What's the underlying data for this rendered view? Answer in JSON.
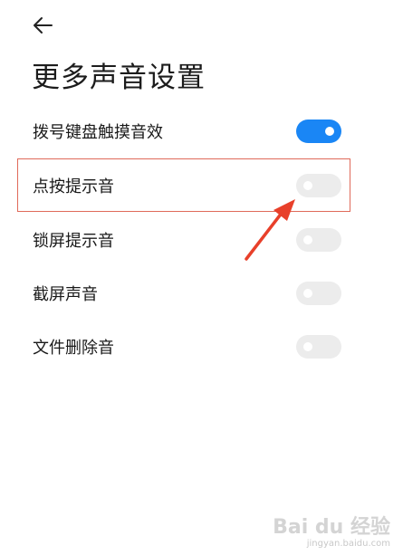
{
  "header": {
    "back_icon": "arrow-left-icon",
    "title": "更多声音设置"
  },
  "settings": [
    {
      "label": "拨号键盘触摸音效",
      "enabled": true
    },
    {
      "label": "点按提示音",
      "enabled": false
    },
    {
      "label": "锁屏提示音",
      "enabled": false
    },
    {
      "label": "截屏声音",
      "enabled": false
    },
    {
      "label": "文件删除音",
      "enabled": false
    }
  ],
  "annotation": {
    "highlight_color": "#e06a5a",
    "arrow_color": "#e8402a"
  },
  "colors": {
    "toggle_on": "#1a86f5",
    "toggle_off": "#ececec"
  },
  "watermark": {
    "logo": "Bai du 经验",
    "url": "jingyan.baidu.com"
  }
}
